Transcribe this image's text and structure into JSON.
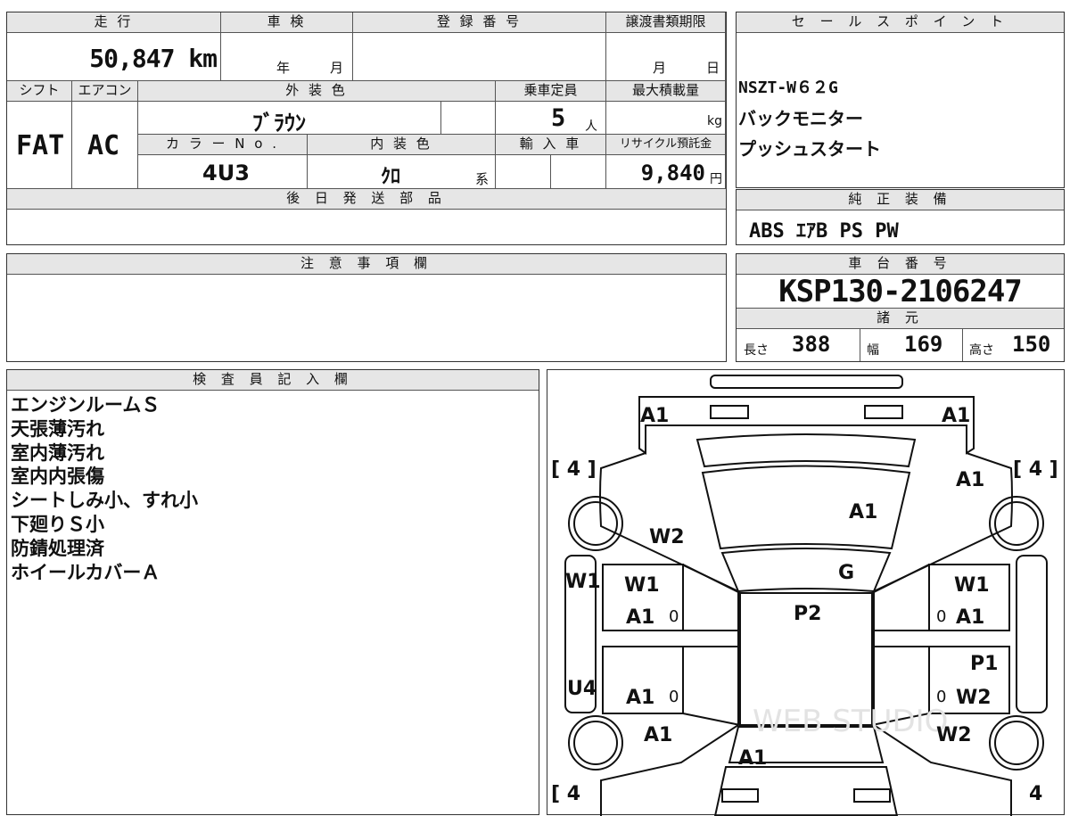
{
  "vehicle_table": {
    "labels": {
      "mileage": "走 行",
      "inspection": "車 検",
      "registration": "登 録 番 号",
      "transfer_deadline": "譲渡書類期限",
      "shift": "シフト",
      "aircon": "エアコン",
      "exterior_color": "外 装 色",
      "capacity": "乗車定員",
      "max_load": "最大積載量",
      "color_no": "カ ラ ー N o .",
      "interior_color": "内 装 色",
      "import": "輸 入 車",
      "recycle": "リサイクル預託金",
      "later_parts": "後 日 発 送 部 品"
    },
    "values": {
      "mileage": "50,847 km",
      "year_unit": "年",
      "month_unit": "月",
      "deadline_month": "月",
      "deadline_day": "日",
      "shift": "FAT",
      "aircon": "AC",
      "exterior_color": "ﾌﾞﾗｳﾝ",
      "capacity": "5",
      "capacity_unit": "人",
      "load_unit": "kg",
      "color_no": "4U3",
      "interior_color": "ｸﾛ",
      "interior_suffix": "系",
      "recycle": "9,840",
      "recycle_unit": "円"
    }
  },
  "sales_points": {
    "header": "セ ー ル ス ポ イ ン ト",
    "lines": [
      "NSZT-W６２G",
      "バックモニター",
      "プッシュスタート"
    ]
  },
  "standard_equipment": {
    "header": "純 正 装 備",
    "value": "ABS ｴｱB PS PW"
  },
  "notes": {
    "header": "注 意 事 項 欄"
  },
  "chassis": {
    "header": "車 台 番 号",
    "value": "KSP130-2106247",
    "specs_header": "諸 元",
    "length_label": "長さ",
    "length": "388",
    "width_label": "幅",
    "width": "169",
    "height_label": "高さ",
    "height": "150"
  },
  "inspector": {
    "header": "検 査 員 記 入 欄",
    "lines": [
      "エンジンルームＳ",
      "天張薄汚れ",
      "室内薄汚れ",
      "室内内張傷",
      "シートしみ小、すれ小",
      "下廻りＳ小",
      "防錆処理済",
      "ホイールカバーＡ"
    ]
  },
  "diagram": {
    "tires": [
      "[ 4 ]",
      "[ 4 ]",
      "[ 4",
      "4"
    ],
    "marks": {
      "front_bumper_left": "A1",
      "front_bumper_right": "A1",
      "hood_right": "A1",
      "hood": "A1",
      "left_fender": "W2",
      "windshield": "G",
      "left_side": "W1",
      "right_side": "W1",
      "left_front_door_1": "W1",
      "left_front_door_2": "A1",
      "right_front_door_2": "A1",
      "roof": "P2",
      "left_rear_door": "A1",
      "right_rear_door_1": "P1",
      "right_rear_door_2": "W2",
      "left_step": "U4",
      "left_rear_fender": "A1",
      "right_rear_fender": "W2",
      "trunk": "A1",
      "zero_1": "0",
      "zero_2": "0",
      "zero_3": "0",
      "zero_4": "0"
    },
    "watermark": "WEB STUDIO"
  }
}
